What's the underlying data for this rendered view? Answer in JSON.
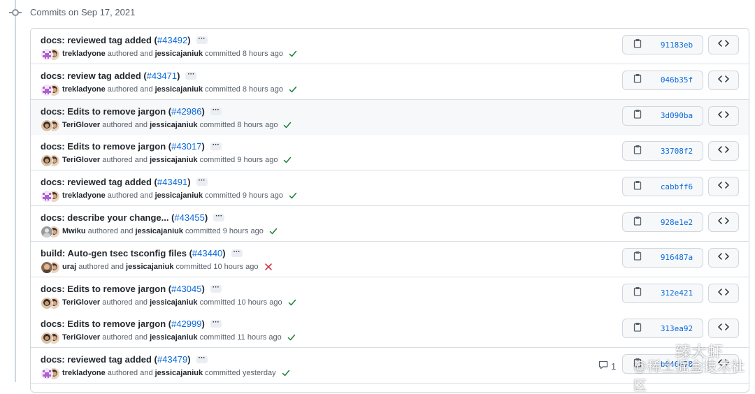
{
  "timeline": {
    "title": "Commits on Sep 17, 2021"
  },
  "commits": [
    {
      "title": "docs: reviewed tag added (",
      "pr": "#43492",
      "pr_close": ")",
      "author": "trekladyone",
      "authored_text": "authored and",
      "committer": "jessicajaniuk",
      "time": "committed 8 hours ago",
      "status": "success",
      "sha": "91183eb",
      "avatar": "pixel"
    },
    {
      "title": "docs: review tag added (",
      "pr": "#43471",
      "pr_close": ")",
      "author": "trekladyone",
      "authored_text": "authored and",
      "committer": "jessicajaniuk",
      "time": "committed 8 hours ago",
      "status": "success",
      "sha": "046b35f",
      "avatar": "pixel"
    },
    {
      "title": "docs: Edits to remove jargon (",
      "pr": "#42986",
      "pr_close": ")",
      "author": "TeriGlover",
      "authored_text": "authored and",
      "committer": "jessicajaniuk",
      "time": "committed 8 hours ago",
      "status": "success",
      "sha": "3d090ba",
      "avatar": "photo"
    },
    {
      "title": "docs: Edits to remove jargon (",
      "pr": "#43017",
      "pr_close": ")",
      "author": "TeriGlover",
      "authored_text": "authored and",
      "committer": "jessicajaniuk",
      "time": "committed 9 hours ago",
      "status": "success",
      "sha": "33708f2",
      "avatar": "photo"
    },
    {
      "title": "docs: reviewed tag added (",
      "pr": "#43491",
      "pr_close": ")",
      "author": "trekladyone",
      "authored_text": "authored and",
      "committer": "jessicajaniuk",
      "time": "committed 9 hours ago",
      "status": "success",
      "sha": "cabbff6",
      "avatar": "pixel"
    },
    {
      "title": "docs: describe your change... (",
      "pr": "#43455",
      "pr_close": ")",
      "author": "Mwiku",
      "authored_text": "authored and",
      "committer": "jessicajaniuk",
      "time": "committed 9 hours ago",
      "status": "success",
      "sha": "928e1e2",
      "avatar": "grey"
    },
    {
      "title": "build: Auto-gen tsec tsconfig files (",
      "pr": "#43440",
      "pr_close": ")",
      "author": "uraj",
      "authored_text": "authored and",
      "committer": "jessicajaniuk",
      "time": "committed 10 hours ago",
      "status": "failure",
      "sha": "916487a",
      "avatar": "brown"
    },
    {
      "title": "docs: Edits to remove jargon (",
      "pr": "#43045",
      "pr_close": ")",
      "author": "TeriGlover",
      "authored_text": "authored and",
      "committer": "jessicajaniuk",
      "time": "committed 10 hours ago",
      "status": "success",
      "sha": "312e421",
      "avatar": "photo"
    },
    {
      "title": "docs: Edits to remove jargon (",
      "pr": "#42999",
      "pr_close": ")",
      "author": "TeriGlover",
      "authored_text": "authored and",
      "committer": "jessicajaniuk",
      "time": "committed 11 hours ago",
      "status": "success",
      "sha": "313ea92",
      "avatar": "photo"
    },
    {
      "title": "docs: reviewed tag added (",
      "pr": "#43479",
      "pr_close": ")",
      "author": "trekladyone",
      "authored_text": "authored and",
      "committer": "jessicajaniuk",
      "time": "committed yesterday",
      "status": "success",
      "sha": "b046e78",
      "avatar": "pixel"
    }
  ],
  "ellipsis_label": "···",
  "comment_count": "1",
  "watermark": {
    "line1": "臻大虾",
    "line2": "@稀土掘金技术社区"
  },
  "colors": {
    "link": "#0969da",
    "success": "#1a7f37",
    "failure": "#cf222e",
    "border": "#d0d7de"
  },
  "icons": {
    "copy": "clipboard-icon",
    "browse": "code-icon",
    "status_success": "check-icon",
    "status_failure": "x-icon",
    "comment": "comment-icon",
    "timeline": "git-commit-icon"
  }
}
